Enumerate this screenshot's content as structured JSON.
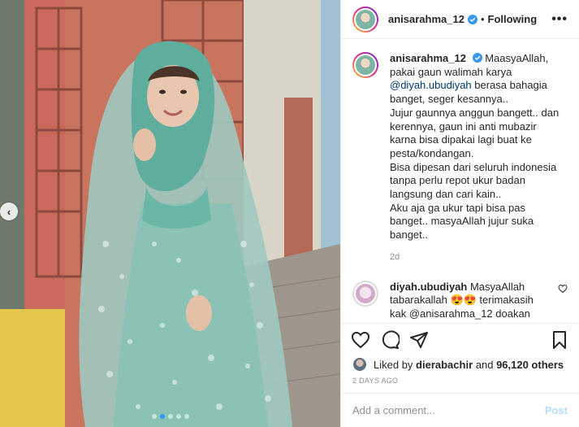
{
  "header": {
    "username": "anisarahma_12",
    "separator": "•",
    "follow_status": "Following",
    "more": "•••"
  },
  "caption": {
    "username": "anisarahma_12",
    "lines": [
      "MaasyaAllah,",
      "pakai gaun walimah karya",
      "@diyah.ubudiyah",
      " berasa bahagia",
      "banget, seger kesannya..",
      "Jujur gaunnya anggun bangett.. dan",
      "kerennya, gaun ini anti mubazir",
      "karna bisa dipakai lagi buat ke",
      "pesta/kondangan.",
      "Bisa dipesan dari seluruh indonesia",
      "tanpa perlu repot ukur badan",
      "langsung dan cari kain..",
      "Aku aja ga ukur tapi bisa pas",
      "banget.. masyaAllah jujur suka",
      "banget.."
    ],
    "time": "2d"
  },
  "reply": {
    "username": "diyah.ubudiyah",
    "text_1": "MasyaAllah",
    "text_2": "tabarakallah 😍😍 terimakasih",
    "text_3": "kak @anisarahma_12 doakan"
  },
  "likes": {
    "prefix": "Liked by ",
    "user": "dierabachir",
    "middle": " and ",
    "count": "96,120 others"
  },
  "date": "2 DAYS AGO",
  "comment_box": {
    "placeholder": "Add a comment...",
    "post_label": "Post"
  },
  "carousel": {
    "prev": "‹",
    "dots_total": 5,
    "active_index": 1
  },
  "icons": [
    "heart-icon",
    "comment-icon",
    "share-icon",
    "bookmark-icon",
    "verified-icon",
    "chevron-left-icon"
  ],
  "colors": {
    "verified": "#3897f0",
    "link": "#00376b",
    "muted": "#8e8e8e",
    "post_disabled": "#b2dffc"
  }
}
